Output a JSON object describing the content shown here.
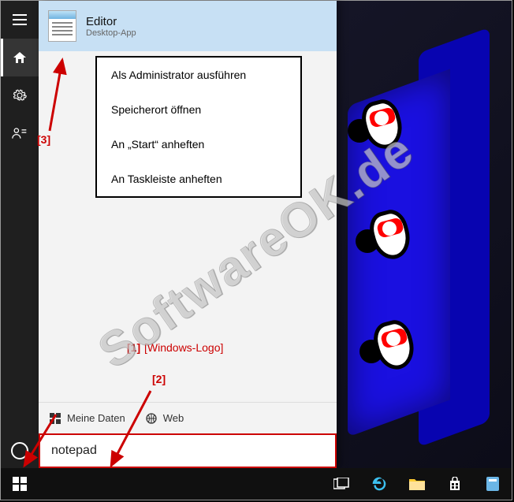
{
  "rail": {
    "items": [
      "menu",
      "home",
      "settings",
      "contact"
    ]
  },
  "best_match": {
    "title": "Editor",
    "subtitle": "Desktop-App"
  },
  "context_menu": {
    "items": [
      "Als Administrator ausführen",
      "Speicherort öffnen",
      "An „Start“ anheften",
      "An Taskleiste anheften"
    ]
  },
  "filters": {
    "my_data": "Meine Daten",
    "web": "Web"
  },
  "search": {
    "value": "notepad"
  },
  "annotations": {
    "a1": "[1]",
    "a1_label": "[Windows-Logo]",
    "a2": "[2]",
    "a3": "[3]"
  },
  "watermark": "SoftwareOK.de"
}
